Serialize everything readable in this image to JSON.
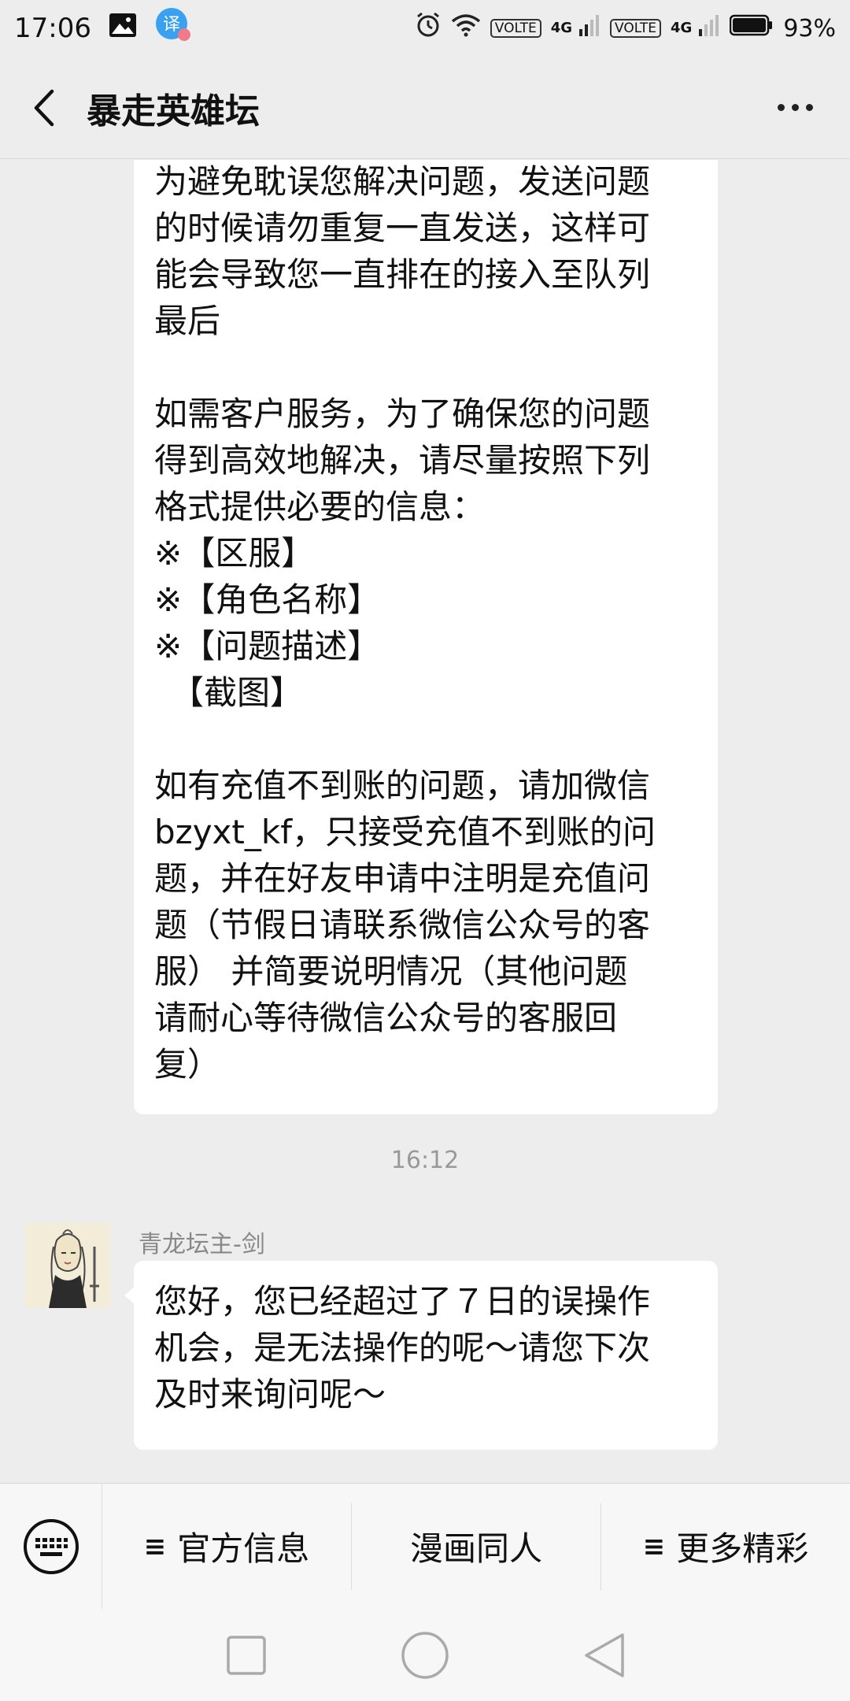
{
  "status_bar": {
    "time": "17:06",
    "left_icons": [
      "image-icon",
      "translate-app-icon"
    ],
    "translate_glyph": "译",
    "volte_1": "VOLTE",
    "net_1": "4G",
    "volte_2": "VOLTE",
    "net_2": "4G",
    "battery": "93%"
  },
  "header": {
    "title": "暴走英雄坛"
  },
  "messages": [
    {
      "text": "为避免耽误您解决问题，发送问题\n的时候请勿重复一直发送，这样可\n能会导致您一直排在的接入至队列\n最后\n\n如需客户服务，为了确保您的问题\n得到高效地解决，请尽量按照下列\n格式提供必要的信息：\n※【区服】\n※【角色名称】\n※【问题描述】\n　【截图】\n\n如有充值不到账的问题，请加微信\nbzyxt_kf，只接受充值不到账的问\n题，并在好友申请中注明是充值问\n题（节假日请联系微信公众号的客\n服） 并简要说明情况（其他问题\n请耐心等待微信公众号的客服回\n复）"
    },
    {
      "timestamp": "16:12",
      "sender": "青龙坛主-剑",
      "text": "您好，您已经超过了７日的误操作\n机会，是无法操作的呢～请您下次\n及时来询问呢～"
    }
  ],
  "menu": {
    "items": [
      {
        "icon": "≡",
        "label": "官方信息"
      },
      {
        "icon": "",
        "label": "漫画同人"
      },
      {
        "icon": "≡",
        "label": "更多精彩"
      }
    ]
  },
  "colors": {
    "background": "#ededed",
    "bubble": "#ffffff",
    "timestamp": "#999999",
    "sender_name": "#888888"
  }
}
